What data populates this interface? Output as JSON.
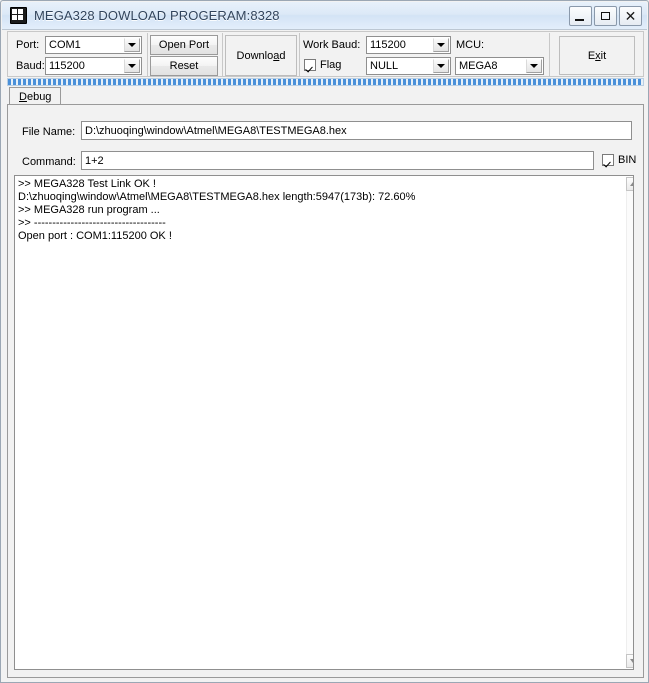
{
  "window": {
    "title": "MEGA328 DOWLOAD PROGERAM:8328",
    "icon": "chip-icon",
    "buttons": {
      "minimize": "minimize-icon",
      "maximize": "maximize-icon",
      "close": "close-icon"
    }
  },
  "toolbar": {
    "port_label": "Port:",
    "port_value": "COM1",
    "baud_label": "Baud:",
    "baud_value": "115200",
    "open_port_label": "Open Port",
    "reset_label": "Reset",
    "download_label_pre": "Downlo",
    "download_label_accel": "a",
    "download_label_post": "d",
    "work_baud_label": "Work Baud:",
    "work_baud_value": "115200",
    "flag_label": "Flag",
    "flag_checked": true,
    "flag_mode_value": "NULL",
    "mcu_label": "MCU:",
    "mcu_value": "MEGA8",
    "exit_label_pre": "E",
    "exit_label_accel": "x",
    "exit_label_post": "it"
  },
  "tabs": [
    {
      "label_accel": "D",
      "label_rest": "ebug",
      "selected": true
    }
  ],
  "form": {
    "file_name_label": "File Name:",
    "file_name_value": "D:\\zhuoqing\\window\\Atmel\\MEGA8\\TESTMEGA8.hex",
    "command_label": "Command:",
    "command_value": "1+2",
    "bin_label": "BIN",
    "bin_checked": true
  },
  "log": {
    "lines": [
      ">> MEGA328 Test Link OK !",
      "D:\\zhuoqing\\window\\Atmel\\MEGA8\\TESTMEGA8.hex length:5947(173b): 72.60%",
      ">> MEGA328 run program ...",
      ">> ------------------------------------",
      "Open port : COM1:115200 OK !"
    ]
  },
  "scrollbar": {
    "up": "scroll-up-icon",
    "down": "scroll-down-icon"
  },
  "colors": {
    "accent": "#4a90d9",
    "title_text": "#31445c",
    "window_bg": "#f2f2f2",
    "field_bg": "#ffffff"
  }
}
